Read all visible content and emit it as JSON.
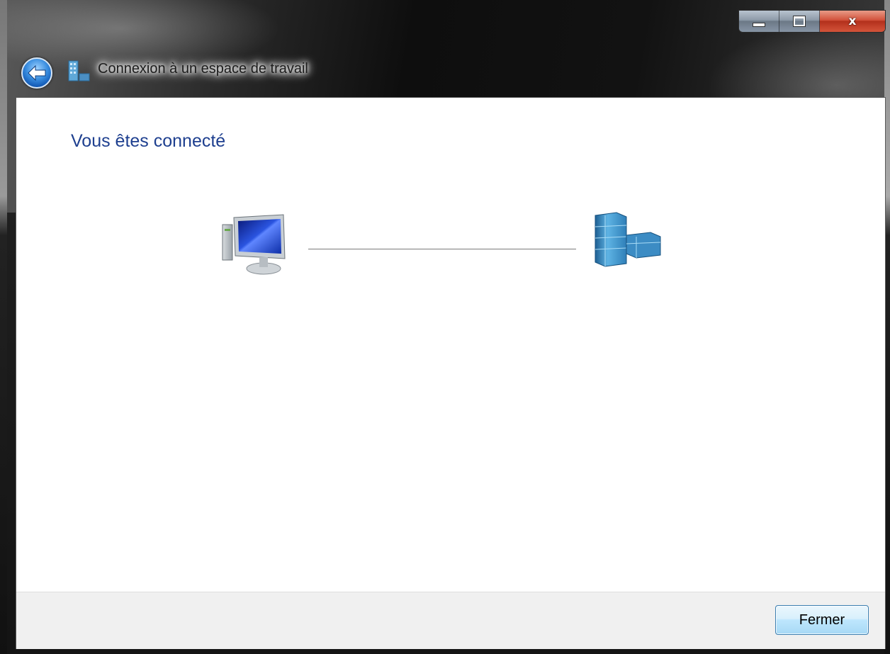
{
  "window": {
    "title": "Connexion à un espace de travail",
    "caption_buttons": {
      "minimize_icon": "minimize-icon",
      "maximize_icon": "maximize-icon",
      "close_label": "x"
    }
  },
  "main": {
    "heading": "Vous êtes connecté",
    "diagram": {
      "left_icon": "computer-icon",
      "right_icon": "workplace-building-icon"
    }
  },
  "footer": {
    "close_button_label": "Fermer"
  },
  "colors": {
    "heading": "#1e3f8f",
    "button_border": "#3c7fb1",
    "close_caption": "#c8412a"
  }
}
